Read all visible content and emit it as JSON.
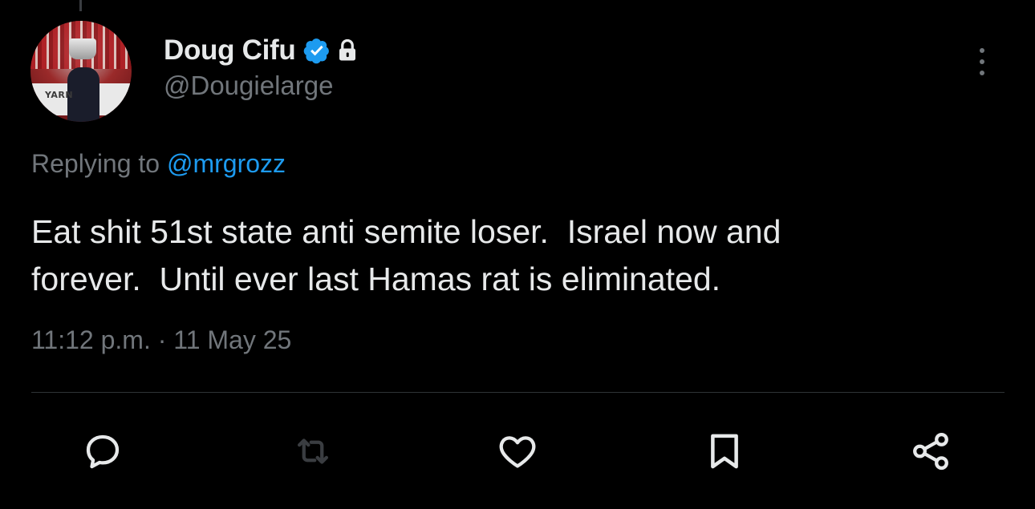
{
  "author": {
    "display_name": "Doug Cifu",
    "handle": "@Dougielarge",
    "avatar_board_text": "YARN",
    "verified_icon": "verified-badge-icon",
    "protected_icon": "lock-icon"
  },
  "reply_context": {
    "prefix": "Replying to ",
    "mention": "@mrgrozz"
  },
  "tweet": {
    "text": "Eat shit 51st state anti semite loser.  Israel now and\nforever.  Until ever last Hamas rat is eliminated.",
    "timestamp": "11:12 p.m. · 11 May 25"
  },
  "actions": [
    {
      "name": "reply",
      "icon": "reply-icon"
    },
    {
      "name": "retweet",
      "icon": "retweet-icon"
    },
    {
      "name": "like",
      "icon": "heart-icon"
    },
    {
      "name": "bookmark",
      "icon": "bookmark-icon"
    },
    {
      "name": "share",
      "icon": "share-icon"
    }
  ],
  "colors": {
    "background": "#000000",
    "text_primary": "#e7e9ea",
    "text_secondary": "#71767b",
    "accent": "#1d9bf0",
    "divider": "#2f3336"
  }
}
